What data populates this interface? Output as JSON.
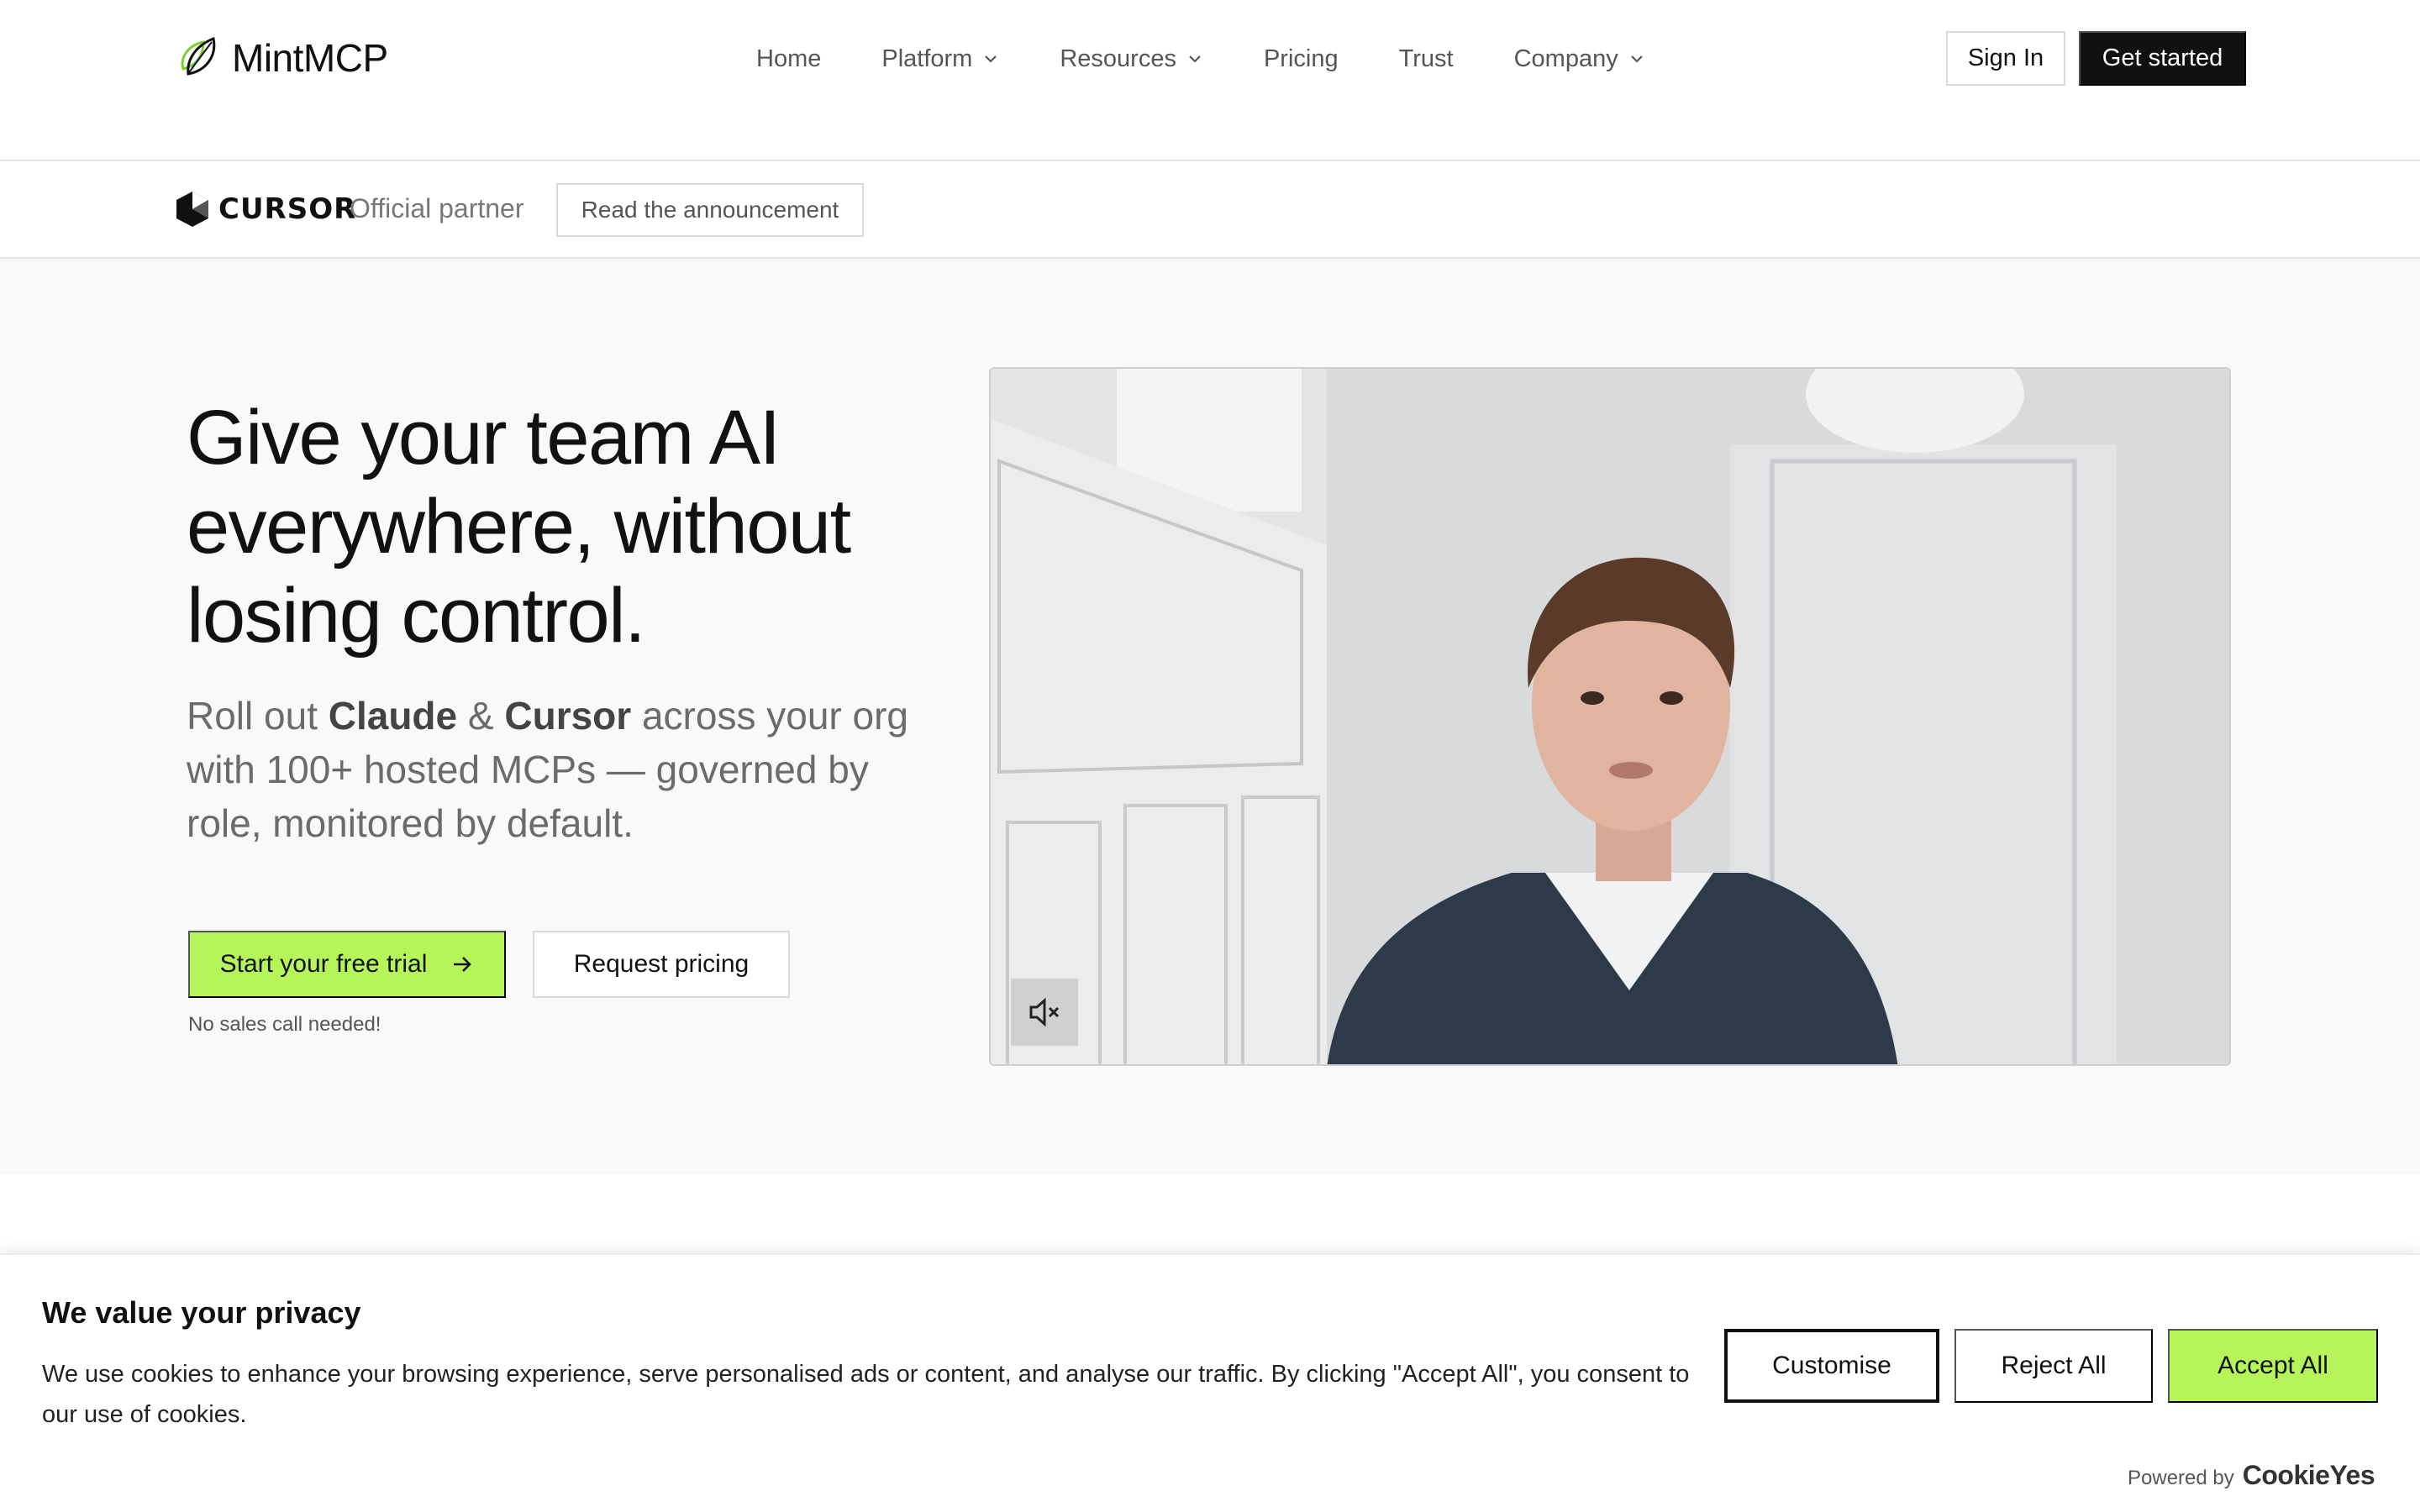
{
  "brand": {
    "name": "MintMCP",
    "accent": "#b6f55a"
  },
  "nav": {
    "items": [
      {
        "label": "Home",
        "dropdown": false
      },
      {
        "label": "Platform",
        "dropdown": true
      },
      {
        "label": "Resources",
        "dropdown": true
      },
      {
        "label": "Pricing",
        "dropdown": false
      },
      {
        "label": "Trust",
        "dropdown": false
      },
      {
        "label": "Company",
        "dropdown": true
      }
    ],
    "sign_in": "Sign In",
    "get_started": "Get started"
  },
  "partner": {
    "logo_text": "CURSOR",
    "text": "Official partner",
    "announcement": "Read the announcement"
  },
  "hero": {
    "title": "Give your team AI everywhere, without losing control.",
    "sub_1": "Roll out ",
    "sub_claude": "Claude",
    "sub_amp": " & ",
    "sub_cursor": "Cursor",
    "sub_2": " across your org with 100+ hosted MCPs — governed by role, monitored by default.",
    "cta_primary": "Start your free trial",
    "cta_secondary": "Request pricing",
    "note": "No sales call needed!"
  },
  "video": {
    "muted": true,
    "mute_icon": "speaker-muted-icon"
  },
  "cookie": {
    "title": "We value your privacy",
    "text": "We use cookies to enhance your browsing experience, serve personalised ads or content, and analyse our traffic. By clicking \"Accept All\", you consent to our use of cookies.",
    "customise": "Customise",
    "reject": "Reject All",
    "accept": "Accept All",
    "powered_by": "Powered by",
    "powered_brand": "CookieYes"
  }
}
